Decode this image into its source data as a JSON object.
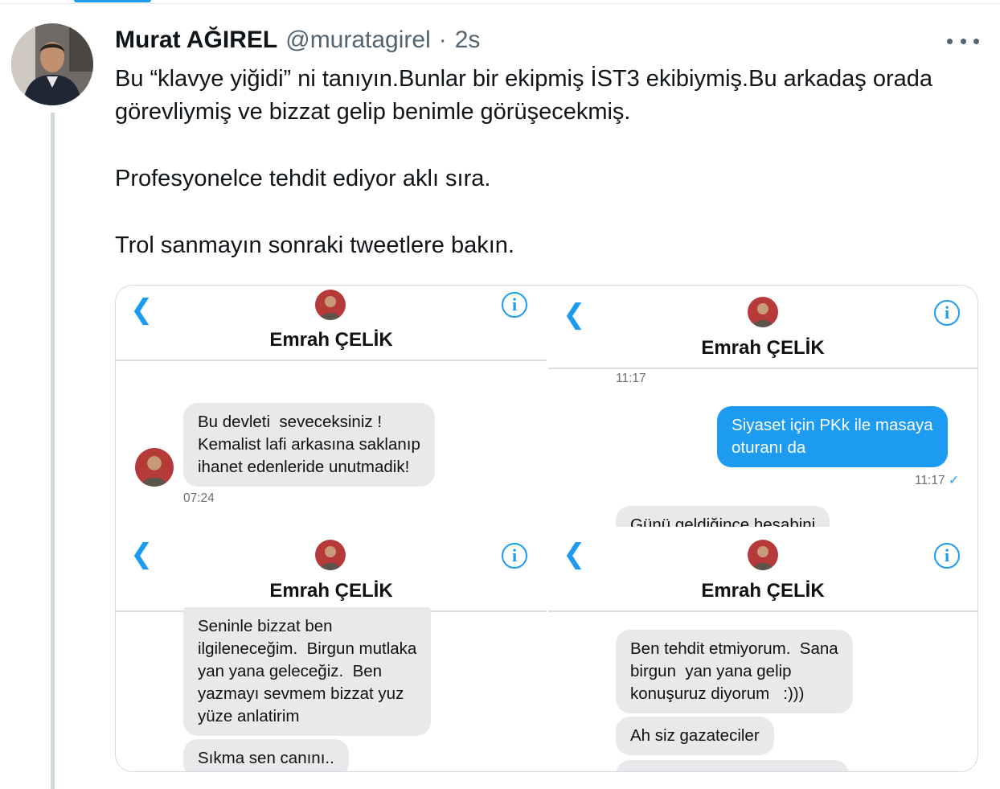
{
  "tweet": {
    "author_name": "Murat AĞIREL",
    "handle": "@muratagirel",
    "separator": "·",
    "time": "2s",
    "paragraphs": [
      "Bu “klavye yiğidi” ni tanıyın.Bunlar bir ekipmiş İST3 ekibiymiş.Bu arkadaş orada görevliymiş ve bizzat gelip benimle görüşecekmiş.",
      "Profesyonelce tehdit ediyor aklı sıra.",
      "Trol sanmayın sonraki tweetlere bakın."
    ]
  },
  "screenshots": [
    {
      "contact_name": "Emrah ÇELİK",
      "message": "Bu devleti  seveceksiniz !\nKemalist lafi arkasına saklanıp\nihanet edenleride unutmadik!",
      "timestamp": "07:24"
    },
    {
      "contact_name": "Emrah ÇELİK",
      "top_time": "11:17",
      "sent_message": "Siyaset için PKk ile masaya\noturanı da",
      "sent_time": "11:17",
      "check": "✓",
      "partial_message": "Günü geldiğince hesabini"
    },
    {
      "contact_name": "Emrah ÇELİK",
      "message": "Seninle bizzat ben\nilgileneceğim.  Birgun mutlaka\nyan yana geleceğiz.  Ben\nyazmayı sevmem bizzat yuz\nyüze anlatirim",
      "message2": "Sıkma sen canını.."
    },
    {
      "contact_name": "Emrah ÇELİK",
      "message": "Ben tehdit etmiyorum.  Sana\nbirgun  yan yana gelip\nkonuşuruz diyorum   :)))",
      "message2": "Ah siz gazateciler"
    }
  ],
  "icons": {
    "back": "chevron-left-icon",
    "info": "info-icon",
    "more": "more-icon"
  },
  "colors": {
    "accent": "#1d9bf0",
    "bubble_gray": "#e9e9eb"
  }
}
